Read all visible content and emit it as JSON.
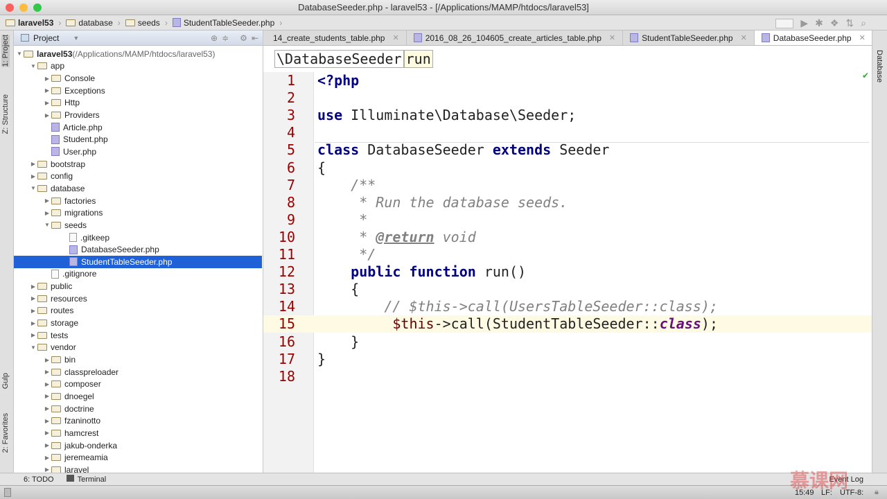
{
  "window": {
    "title": "DatabaseSeeder.php - laravel53 - [/Applications/MAMP/htdocs/laravel53]"
  },
  "breadcrumb": [
    "laravel53",
    "database",
    "seeds",
    "StudentTableSeeder.php"
  ],
  "left_strip": {
    "project": "1: Project",
    "structure": "Z: Structure",
    "gulp": "Gulp",
    "favorites": "2: Favorites"
  },
  "project_panel": {
    "title": "Project"
  },
  "tree": [
    {
      "label": "laravel53",
      "extra": " (/Applications/MAMP/htdocs/laravel53)",
      "level": 0,
      "type": "folder",
      "arrow": "open",
      "bold": true
    },
    {
      "label": "app",
      "level": 1,
      "type": "folder",
      "arrow": "open"
    },
    {
      "label": "Console",
      "level": 2,
      "type": "folder",
      "arrow": "closed"
    },
    {
      "label": "Exceptions",
      "level": 2,
      "type": "folder",
      "arrow": "closed"
    },
    {
      "label": "Http",
      "level": 2,
      "type": "folder",
      "arrow": "closed"
    },
    {
      "label": "Providers",
      "level": 2,
      "type": "folder",
      "arrow": "closed"
    },
    {
      "label": "Article.php",
      "level": 2,
      "type": "php"
    },
    {
      "label": "Student.php",
      "level": 2,
      "type": "php"
    },
    {
      "label": "User.php",
      "level": 2,
      "type": "php"
    },
    {
      "label": "bootstrap",
      "level": 1,
      "type": "folder",
      "arrow": "closed"
    },
    {
      "label": "config",
      "level": 1,
      "type": "folder",
      "arrow": "closed"
    },
    {
      "label": "database",
      "level": 1,
      "type": "folder",
      "arrow": "open"
    },
    {
      "label": "factories",
      "level": 2,
      "type": "folder",
      "arrow": "closed"
    },
    {
      "label": "migrations",
      "level": 2,
      "type": "folder",
      "arrow": "closed"
    },
    {
      "label": "seeds",
      "level": 2,
      "type": "folder",
      "arrow": "open"
    },
    {
      "label": ".gitkeep",
      "level": 3,
      "type": "txt"
    },
    {
      "label": "DatabaseSeeder.php",
      "level": 3,
      "type": "php"
    },
    {
      "label": "StudentTableSeeder.php",
      "level": 3,
      "type": "php",
      "selected": true
    },
    {
      "label": ".gitignore",
      "level": 2,
      "type": "txt"
    },
    {
      "label": "public",
      "level": 1,
      "type": "folder",
      "arrow": "closed"
    },
    {
      "label": "resources",
      "level": 1,
      "type": "folder",
      "arrow": "closed"
    },
    {
      "label": "routes",
      "level": 1,
      "type": "folder",
      "arrow": "closed"
    },
    {
      "label": "storage",
      "level": 1,
      "type": "folder",
      "arrow": "closed"
    },
    {
      "label": "tests",
      "level": 1,
      "type": "folder",
      "arrow": "closed"
    },
    {
      "label": "vendor",
      "level": 1,
      "type": "folder",
      "arrow": "open"
    },
    {
      "label": "bin",
      "level": 2,
      "type": "folder",
      "arrow": "closed"
    },
    {
      "label": "classpreloader",
      "level": 2,
      "type": "folder",
      "arrow": "closed"
    },
    {
      "label": "composer",
      "level": 2,
      "type": "folder",
      "arrow": "closed"
    },
    {
      "label": "dnoegel",
      "level": 2,
      "type": "folder",
      "arrow": "closed"
    },
    {
      "label": "doctrine",
      "level": 2,
      "type": "folder",
      "arrow": "closed"
    },
    {
      "label": "fzaninotto",
      "level": 2,
      "type": "folder",
      "arrow": "closed"
    },
    {
      "label": "hamcrest",
      "level": 2,
      "type": "folder",
      "arrow": "closed"
    },
    {
      "label": "jakub-onderka",
      "level": 2,
      "type": "folder",
      "arrow": "closed"
    },
    {
      "label": "jeremeamia",
      "level": 2,
      "type": "folder",
      "arrow": "closed"
    },
    {
      "label": "laravel",
      "level": 2,
      "type": "folder",
      "arrow": "closed"
    }
  ],
  "tabs": [
    {
      "label": "14_create_students_table.php",
      "icon": false
    },
    {
      "label": "2016_08_26_104605_create_articles_table.php",
      "icon": true
    },
    {
      "label": "StudentTableSeeder.php",
      "icon": true
    },
    {
      "label": "DatabaseSeeder.php",
      "icon": true,
      "active": true
    }
  ],
  "tab_overflow": "7",
  "navbar": {
    "class": "\\DatabaseSeeder",
    "method": "run"
  },
  "right_strip": {
    "database": "Database"
  },
  "code": [
    [
      [
        "<?php",
        "kw"
      ]
    ],
    [],
    [
      [
        "use",
        "kw"
      ],
      [
        " Illuminate\\Database\\Seeder;",
        ""
      ]
    ],
    [],
    [
      [
        "class",
        "kw"
      ],
      [
        " DatabaseSeeder ",
        ""
      ],
      [
        "extends",
        "kw"
      ],
      [
        " Seeder",
        ""
      ]
    ],
    [
      [
        "{",
        ""
      ]
    ],
    [
      [
        "    /**",
        "cm"
      ]
    ],
    [
      [
        "     * Run the database seeds.",
        "cm"
      ]
    ],
    [
      [
        "     *",
        "cm"
      ]
    ],
    [
      [
        "     * ",
        "cm"
      ],
      [
        "@return",
        "doc"
      ],
      [
        " void",
        "cm"
      ]
    ],
    [
      [
        "     */",
        "cm"
      ]
    ],
    [
      [
        "    ",
        ""
      ],
      [
        "public function",
        "kw"
      ],
      [
        " run()",
        ""
      ]
    ],
    [
      [
        "    {",
        ""
      ]
    ],
    [
      [
        "        // $this->call(UsersTableSeeder::class);",
        "cm"
      ]
    ],
    [
      [
        "         ",
        ""
      ],
      [
        "$this",
        "var"
      ],
      [
        "->call(StudentTableSeeder::",
        ""
      ],
      [
        "class",
        "cls"
      ],
      [
        ");",
        ""
      ]
    ],
    [
      [
        "    }",
        ""
      ]
    ],
    [
      [
        "}",
        ""
      ]
    ],
    []
  ],
  "current_line": 15,
  "bottom": {
    "todo": "6: TODO",
    "terminal": "Terminal",
    "event_log": "Event Log"
  },
  "status": {
    "time": "15:49",
    "line_sep": "LF:",
    "encoding": "UTF-8:"
  },
  "watermark": "慕课网"
}
